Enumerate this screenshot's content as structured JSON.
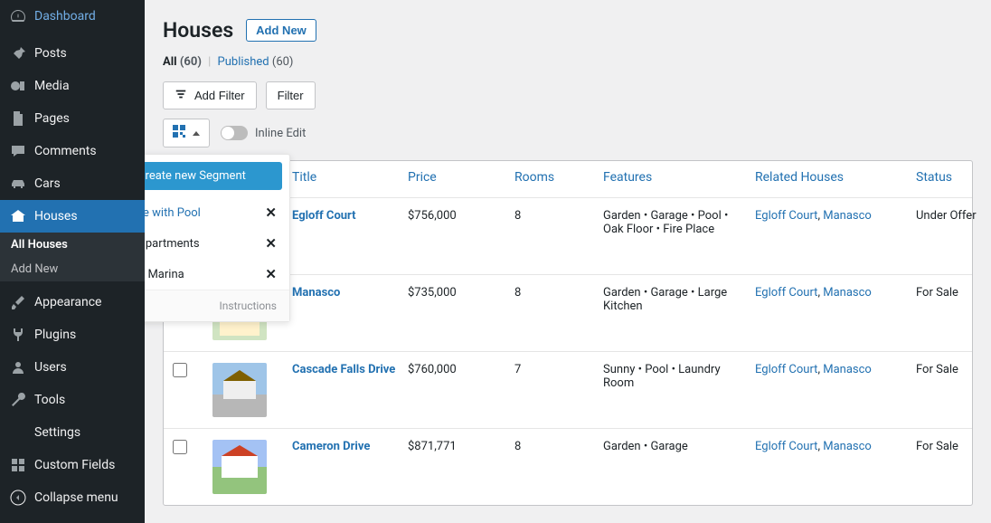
{
  "sidebar": {
    "items": [
      {
        "label": "Dashboard"
      },
      {
        "label": "Posts"
      },
      {
        "label": "Media"
      },
      {
        "label": "Pages"
      },
      {
        "label": "Comments"
      },
      {
        "label": "Cars"
      },
      {
        "label": "Houses"
      },
      {
        "label": "Appearance"
      },
      {
        "label": "Plugins"
      },
      {
        "label": "Users"
      },
      {
        "label": "Tools"
      },
      {
        "label": "Settings"
      },
      {
        "label": "Custom Fields"
      },
      {
        "label": "Collapse menu"
      }
    ],
    "submenu": {
      "all": "All Houses",
      "add": "Add New"
    }
  },
  "header": {
    "title": "Houses",
    "add_new": "Add New"
  },
  "subsub": {
    "all_label": "All",
    "all_count": "(60)",
    "published_label": "Published",
    "published_count": "(60)"
  },
  "toolbar": {
    "add_filter": "Add Filter",
    "filter": "Filter",
    "inline_edit": "Inline Edit"
  },
  "columns": {
    "title": "Title",
    "price": "Price",
    "rooms": "Rooms",
    "features": "Features",
    "related": "Related Houses",
    "status": "Status"
  },
  "segments": {
    "create": "Create new Segment",
    "items": [
      {
        "label": "For Sale with Pool",
        "active": true
      },
      {
        "label": "Large apartments",
        "active": false
      },
      {
        "label": "Sold by Marina",
        "active": false
      }
    ],
    "instructions": "Instructions"
  },
  "rows": [
    {
      "title": "Egloff Court",
      "price": "$756,000",
      "rooms": "8",
      "features": "Garden • Garage • Pool • Oak Floor • Fire Place",
      "related": [
        "Egloff Court",
        "Manasco"
      ],
      "status": "Under Offer"
    },
    {
      "title": "Manasco",
      "price": "$735,000",
      "rooms": "8",
      "features": "Garden • Garage • Large Kitchen",
      "related": [
        "Egloff Court",
        "Manasco"
      ],
      "status": "For Sale"
    },
    {
      "title": "Cascade Falls Drive",
      "price": "$760,000",
      "rooms": "7",
      "features": "Sunny • Pool • Laundry Room",
      "related": [
        "Egloff Court",
        "Manasco"
      ],
      "status": "For Sale"
    },
    {
      "title": "Cameron Drive",
      "price": "$871,771",
      "rooms": "8",
      "features": "Garden • Garage",
      "related": [
        "Egloff Court",
        "Manasco"
      ],
      "status": "For Sale"
    }
  ]
}
